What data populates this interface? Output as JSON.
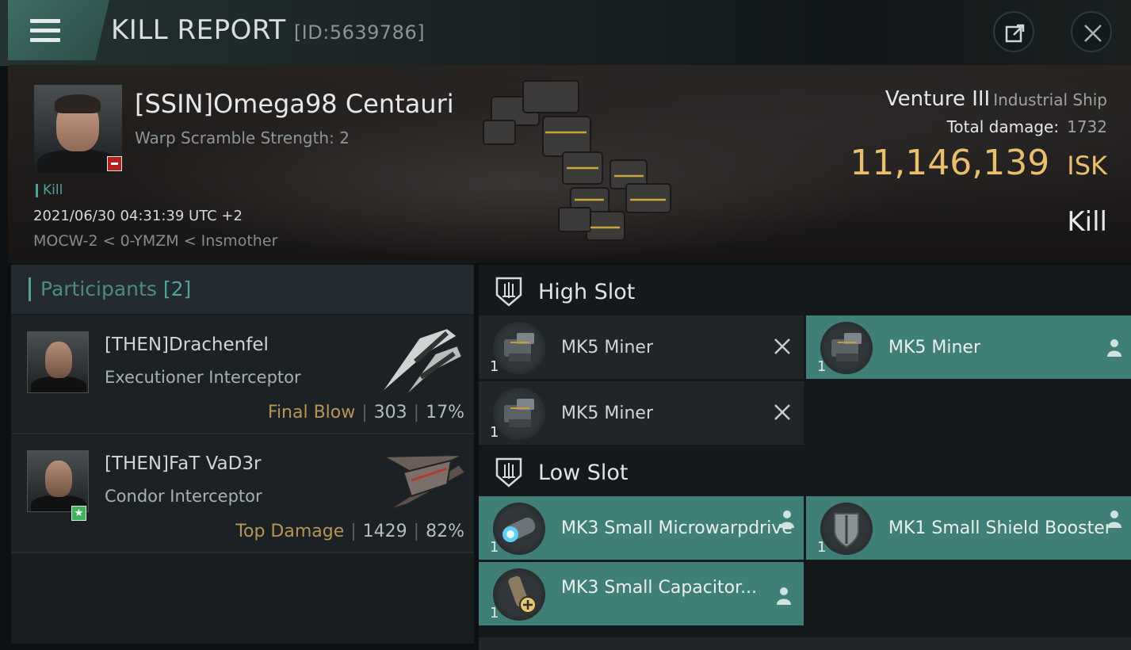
{
  "header": {
    "title": "KILL REPORT",
    "id_label": "[ID:5639786]",
    "icons": [
      "menu-icon",
      "share-icon",
      "close-icon"
    ]
  },
  "victim": {
    "name": "[SSIN]Omega98 Centauri",
    "warp_scramble": "Warp Scramble Strength: 2",
    "tag": "Kill",
    "timestamp": "2021/06/30 04:31:39 UTC +2",
    "location": "MOCW-2 < 0-YMZM < Insmother",
    "ship": "Venture III",
    "ship_class": "Industrial Ship",
    "total_damage_label": "Total damage:",
    "total_damage": "1732",
    "isk_value": "11,146,139",
    "isk_unit": "ISK",
    "result": "Kill"
  },
  "participants": {
    "label": "Participants",
    "count": "[2]",
    "list": [
      {
        "name": "[THEN]Drachenfel",
        "ship": "Executioner Interceptor",
        "tag": "Final Blow",
        "damage": "303",
        "percent": "17%"
      },
      {
        "name": "[THEN]FaT VaD3r",
        "ship": "Condor Interceptor",
        "tag": "Top Damage",
        "damage": "1429",
        "percent": "82%"
      }
    ]
  },
  "fittings": {
    "high_slot": {
      "label": "High Slot",
      "items": [
        {
          "name": "MK5 Miner",
          "qty": "1",
          "state": "destroyed"
        },
        {
          "name": "MK5 Miner",
          "qty": "1",
          "state": "dropped"
        },
        {
          "name": "MK5 Miner",
          "qty": "1",
          "state": "destroyed"
        }
      ]
    },
    "low_slot": {
      "label": "Low Slot",
      "items": [
        {
          "name": "MK3 Small Microwarpdrive",
          "qty": "1",
          "state": "dropped"
        },
        {
          "name": "MK1 Small Shield Booster",
          "qty": "1",
          "state": "dropped"
        },
        {
          "name": "MK3 Small Capacitor...",
          "qty": "1",
          "state": "dropped"
        }
      ]
    }
  },
  "colors": {
    "accent_teal": "#3f7f77",
    "isk_gold": "#e8c06d",
    "final_blow_tag": "#b89552",
    "negative_badge": "#b5221c",
    "positive_badge": "#3fb25b"
  }
}
